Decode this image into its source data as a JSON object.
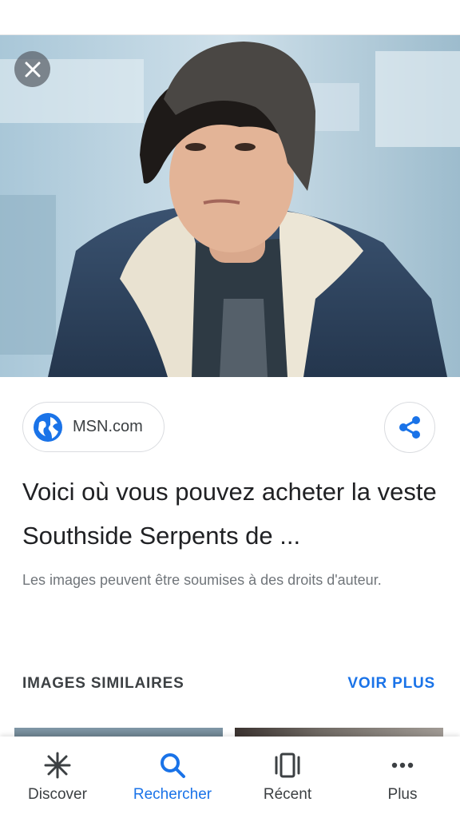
{
  "colors": {
    "accent": "#1a73e8",
    "text_primary": "#202124",
    "text_secondary": "#70757a",
    "nav_inactive": "#3c4043"
  },
  "image_viewer": {
    "close_icon": "close-icon",
    "source": {
      "name": "MSN.com",
      "icon": "globe-icon"
    },
    "share_icon": "share-icon",
    "title": "Voici où vous pouvez acheter la veste Southside Serpents de ...",
    "copyright_notice": "Les images peuvent être soumises à des droits d'auteur."
  },
  "similar_images": {
    "heading": "IMAGES SIMILAIRES",
    "see_more": "VOIR PLUS"
  },
  "bottom_nav": {
    "items": [
      {
        "label": "Discover",
        "icon": "asterisk-icon",
        "active": false
      },
      {
        "label": "Rechercher",
        "icon": "search-icon",
        "active": true
      },
      {
        "label": "Récent",
        "icon": "recent-cards-icon",
        "active": false
      },
      {
        "label": "Plus",
        "icon": "more-dots-icon",
        "active": false
      }
    ]
  }
}
